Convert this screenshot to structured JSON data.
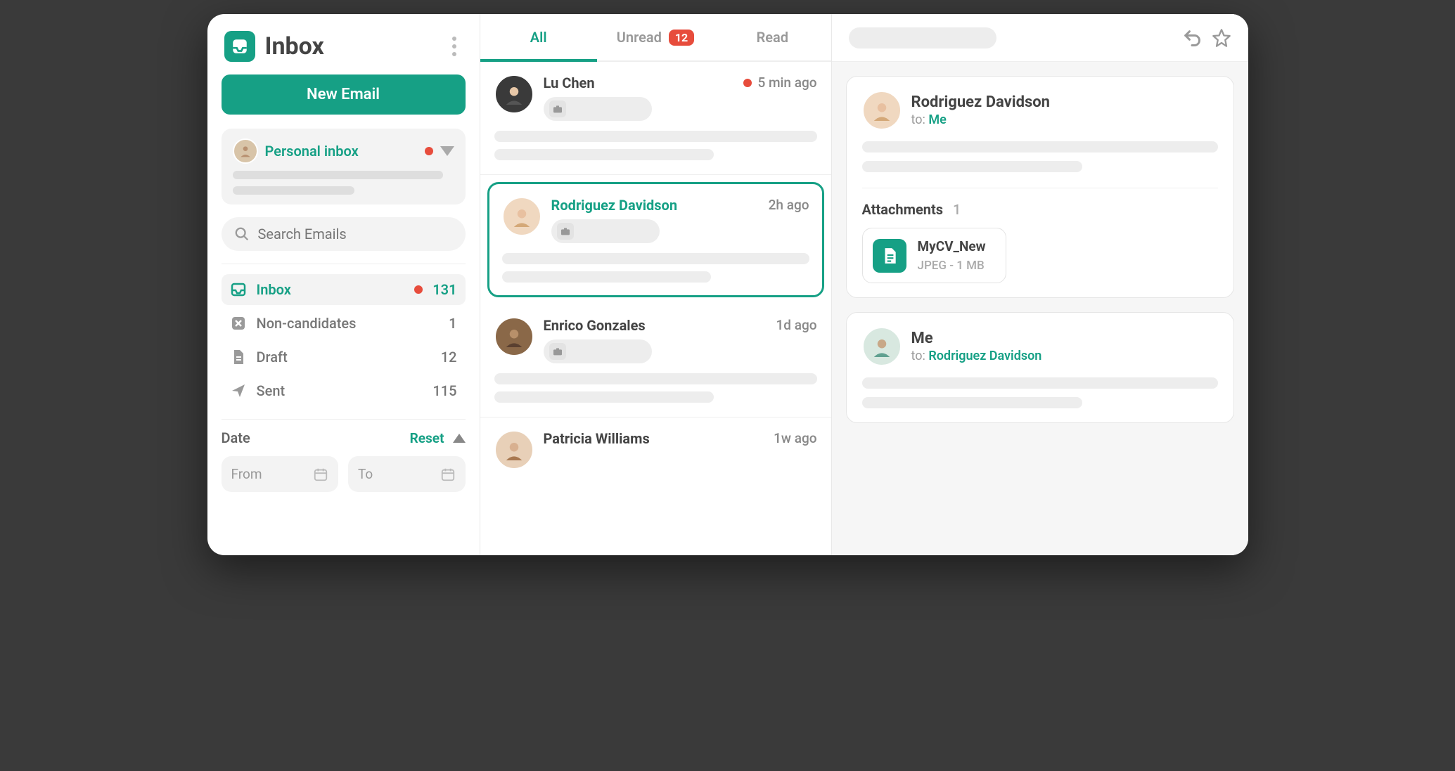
{
  "sidebar": {
    "title": "Inbox",
    "new_email": "New Email",
    "account_name": "Personal inbox",
    "search_placeholder": "Search Emails",
    "folders": [
      {
        "label": "Inbox",
        "count": "131",
        "has_dot": true,
        "active": true,
        "icon": "inbox"
      },
      {
        "label": "Non-candidates",
        "count": "1",
        "icon": "x-box"
      },
      {
        "label": "Draft",
        "count": "12",
        "icon": "file"
      },
      {
        "label": "Sent",
        "count": "115",
        "icon": "send"
      }
    ],
    "date": {
      "title": "Date",
      "reset": "Reset",
      "from": "From",
      "to": "To"
    }
  },
  "tabs": {
    "all": "All",
    "unread": "Unread",
    "unread_count": "12",
    "read": "Read"
  },
  "emails": [
    {
      "name": "Lu Chen",
      "time": "5 min ago",
      "unread": true,
      "selected": false
    },
    {
      "name": "Rodriguez Davidson",
      "time": "2h ago",
      "unread": false,
      "selected": true
    },
    {
      "name": "Enrico Gonzales",
      "time": "1d ago",
      "unread": false,
      "selected": false
    },
    {
      "name": "Patricia Williams",
      "time": "1w ago",
      "unread": false,
      "selected": false
    }
  ],
  "thread": {
    "messages": [
      {
        "from": "Rodriguez Davidson",
        "to_label": "to:",
        "to": "Me",
        "has_attachments": true
      },
      {
        "from": "Me",
        "to_label": "to:",
        "to": "Rodriguez Davidson",
        "has_attachments": false
      }
    ],
    "attachments_label": "Attachments",
    "attachments_count": "1",
    "attachment": {
      "name": "MyCV_New",
      "meta": "JPEG - 1 MB"
    }
  }
}
